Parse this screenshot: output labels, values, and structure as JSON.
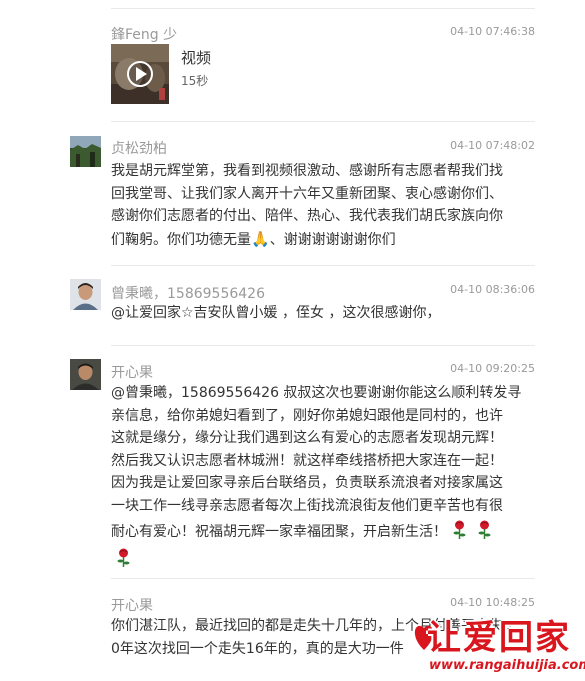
{
  "messages": [
    {
      "name": "鋒Feng 少",
      "time": "04-10 07:46:38",
      "video": {
        "title": "视频",
        "duration": "15秒",
        "icon": "play-icon"
      }
    },
    {
      "name": "贞松劲柏",
      "time": "04-10 07:48:02",
      "lines": [
        "我是胡元辉堂第，我看到视频很激动、感谢所有志愿者帮我们找",
        "回我堂哥、让我们家人离开十六年又重新团聚、衷心感谢你们、",
        "感谢你们志愿者的付出、陪伴、热心、我代表我们胡氏家族向你",
        "们鞠躬。你们功德无量"
      ],
      "tail": "、谢谢谢谢谢谢你们",
      "emoji": "🙏"
    },
    {
      "name": "曾秉曦，15869556426",
      "time": "04-10 08:36:06",
      "lines": [
        "@让爱回家☆吉安队曾小媛 ，侄女 ，这次很感谢你，"
      ]
    },
    {
      "name": "开心果",
      "time": "04-10 09:20:25",
      "lines": [
        "@曾秉曦，15869556426 叔叔这次也要谢谢你能这么顺利转发寻",
        "亲信息，给你弟媳妇看到了，刚好你弟媳妇跟他是同村的，也许",
        "这就是缘分，缘分让我们遇到这么有爱心的志愿者发现胡元辉！",
        "然后我又认识志愿者林城洲！就这样牵线搭桥把大家连在一起！",
        "因为我是让爱回家寻亲后台联络员，负责联系流浪者对接家属这",
        "一块工作一线寻亲志愿者每次上街找流浪街友他们更辛苦也有很",
        "耐心有爱心！祝福胡元辉一家幸福团聚，开启新生活！"
      ],
      "rose_icon": "rose-icon"
    },
    {
      "name": "开心果",
      "time": "04-10 10:48:25",
      "lines": [
        "你们湛江队，最近找回的都是走失十几年的，上个月付善平走失3",
        "0年这次找回一个走失16年的，真的是大功一件"
      ]
    }
  ],
  "watermark": {
    "title": "让爱回家",
    "url": "www.rangaihuijia.com"
  },
  "colors": {
    "name": "#9a9a9a",
    "text": "#333333",
    "divider": "#e9e9e9",
    "brand": "#d9161e"
  }
}
